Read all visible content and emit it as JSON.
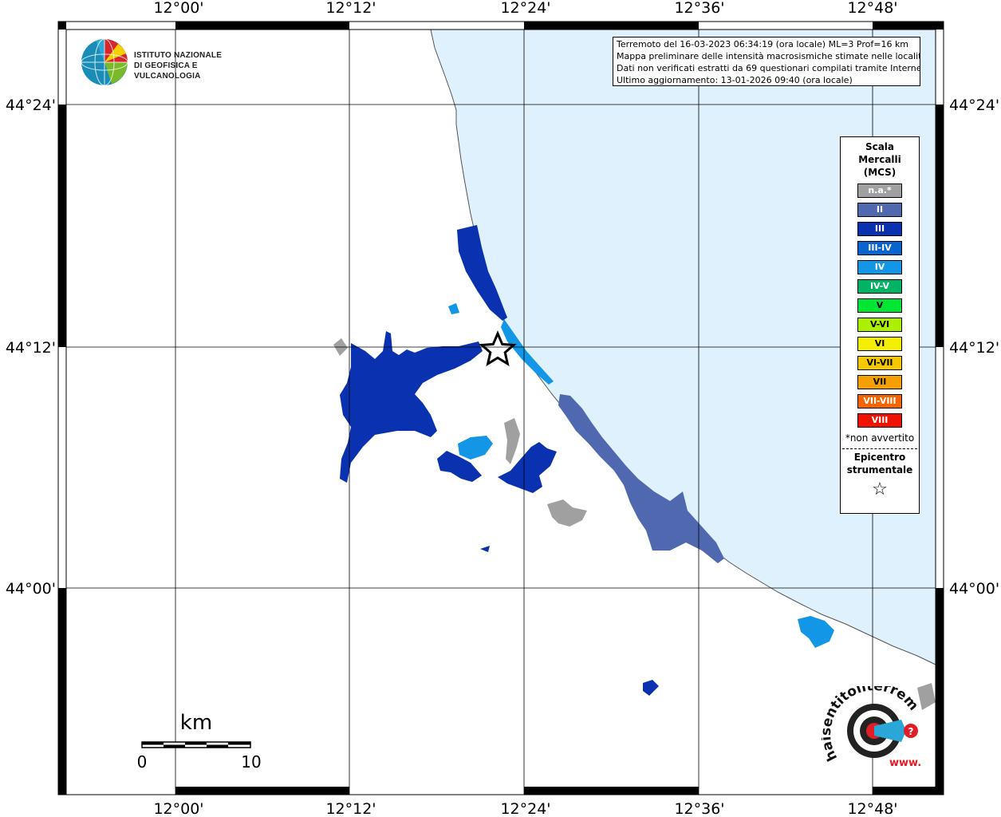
{
  "header": {
    "line1": "Terremoto del 16-03-2023 06:34:19 (ora locale) ML=3 Prof=16 km",
    "line2": "Mappa preliminare delle intensità macrosismiche stimate nelle località",
    "line3": "Dati non verificati estratti da 69 questionari compilati tramite Internet.",
    "line4": "Ultimo aggiornamento: 13-01-2026 09:40 (ora locale)"
  },
  "logo": {
    "line1": "ISTITUTO NAZIONALE",
    "line2": "DI GEOFISICA E VULCANOLOGIA"
  },
  "axes": {
    "lon_labels": [
      "12°00'",
      "12°12'",
      "12°24'",
      "12°36'",
      "12°48'"
    ],
    "lat_labels": [
      "44°24'",
      "44°12'",
      "44°00'"
    ]
  },
  "legend": {
    "title_line1": "Scala",
    "title_line2": "Mercalli",
    "title_line3": "(MCS)",
    "items": [
      {
        "label": "n.a.*",
        "color": "#a0a0a0"
      },
      {
        "label": "II",
        "color": "#5068b0"
      },
      {
        "label": "III",
        "color": "#0a32b0"
      },
      {
        "label": "III-IV",
        "color": "#0a64d0"
      },
      {
        "label": "IV",
        "color": "#1496e6"
      },
      {
        "label": "IV-V",
        "color": "#00b464"
      },
      {
        "label": "V",
        "color": "#00e632"
      },
      {
        "label": "V-VI",
        "color": "#aaf000"
      },
      {
        "label": "VI",
        "color": "#f5f000"
      },
      {
        "label": "VI-VII",
        "color": "#f5c800"
      },
      {
        "label": "VII",
        "color": "#f5a000"
      },
      {
        "label": "VII-VIII",
        "color": "#f56400"
      },
      {
        "label": "VIII",
        "color": "#f01400"
      }
    ],
    "note": "*non avvertito",
    "epicenter_line1": "Epicentro",
    "epicenter_line2": "strumentale",
    "epicenter_symbol": "☆"
  },
  "scalebar": {
    "unit": "km",
    "min_label": "0",
    "max_label": "10"
  },
  "hst_logo": {
    "text": "haisentitoilterremoto.it",
    "text2": "www."
  },
  "colors": {
    "sea": "#dff1fd",
    "land": "#ffffff",
    "grid": "#000000"
  }
}
